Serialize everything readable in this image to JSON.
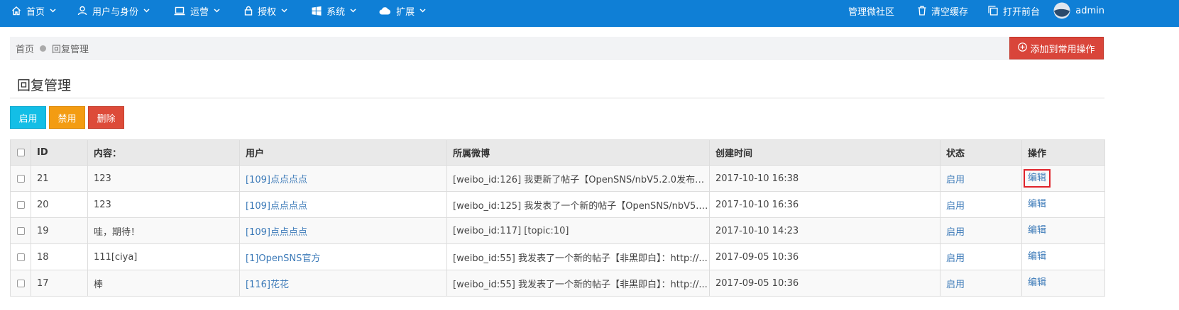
{
  "navbar": {
    "left": [
      {
        "label": "首页",
        "icon": "home-icon"
      },
      {
        "label": "用户与身份",
        "icon": "user-icon"
      },
      {
        "label": "运营",
        "icon": "laptop-icon"
      },
      {
        "label": "授权",
        "icon": "lock-icon"
      },
      {
        "label": "系统",
        "icon": "windows-icon"
      },
      {
        "label": "扩展",
        "icon": "cloud-icon"
      }
    ],
    "right": {
      "community": "管理微社区",
      "clear_cache": "清空缓存",
      "open_front": "打开前台",
      "user": "admin"
    },
    "color": "#0f7fd6"
  },
  "breadcrumb": {
    "home": "首页",
    "current": "回复管理"
  },
  "add_op_button": "添加到常用操作",
  "page_title": "回复管理",
  "actions": {
    "enable": "启用",
    "disable": "禁用",
    "delete": "删除"
  },
  "table": {
    "headers": {
      "id": "ID",
      "content": "内容：",
      "user": "用户",
      "weibo": "所属微博",
      "created": "创建时间",
      "status": "状态",
      "operate": "操作"
    },
    "rows": [
      {
        "id": "21",
        "content": "123",
        "user": "[109]点点点点",
        "weibo": "[weibo_id:126] 我更新了帖子【OpenSNS/nbV5.2.0发布，...",
        "created": "2017-10-10 16:38",
        "status": "启用",
        "edit": "编辑"
      },
      {
        "id": "20",
        "content": "123",
        "user": "[109]点点点点",
        "weibo": "[weibo_id:125] 我发表了一个新的帖子【OpenSNS/nbV5.2....",
        "created": "2017-10-10 16:36",
        "status": "启用",
        "edit": "编辑"
      },
      {
        "id": "19",
        "content": "哇，期待！",
        "user": "[109]点点点点",
        "weibo": "[weibo_id:117] [topic:10]",
        "created": "2017-10-10 14:23",
        "status": "启用",
        "edit": "编辑"
      },
      {
        "id": "18",
        "content": "111[ciya]",
        "user": "[1]OpenSNS官方",
        "weibo": "[weibo_id:55] 我发表了一个新的帖子【非黑即白】：http://...",
        "created": "2017-09-05 10:36",
        "status": "启用",
        "edit": "编辑"
      },
      {
        "id": "17",
        "content": "棒",
        "user": "[116]花花",
        "weibo": "[weibo_id:55] 我发表了一个新的帖子【非黑即白】：http://...",
        "created": "2017-09-05 10:36",
        "status": "启用",
        "edit": "编辑"
      }
    ]
  }
}
